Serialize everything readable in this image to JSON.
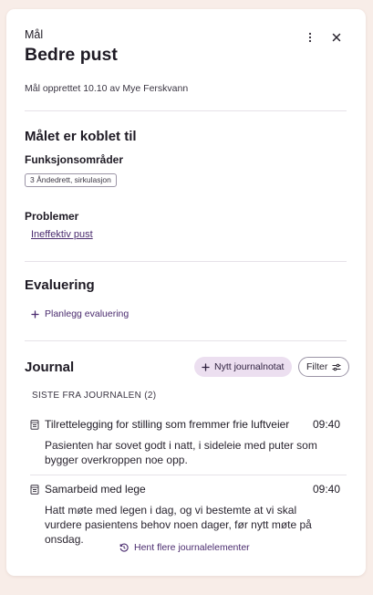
{
  "header": {
    "eyebrow": "Mål",
    "title": "Bedre pust",
    "meta": "Mål opprettet 10.10 av Mye Ferskvann"
  },
  "links_section": {
    "heading": "Målet er koblet til",
    "functional_areas_label": "Funksjonsområder",
    "functional_area_tag": "3 Åndedrett, sirkulasjon",
    "problems_label": "Problemer",
    "problem_link": "Ineffektiv pust"
  },
  "evaluation": {
    "heading": "Evaluering",
    "plan_button": "Planlegg evaluering"
  },
  "journal": {
    "heading": "Journal",
    "new_note_button": "Nytt journalnotat",
    "filter_button": "Filter",
    "recent_label": "SISTE FRA JOURNALEN (2)",
    "entries": [
      {
        "title": "Tilrettelegging for stilling som fremmer frie luftveier",
        "time": "09:40",
        "body": "Pasienten har sovet godt i natt, i sideleie med puter som bygger overkroppen noe opp."
      },
      {
        "title": "Samarbeid med lege",
        "time": "09:40",
        "body": "Hatt møte med legen i dag, og vi bestemte at vi skal vurdere pasientens behov noen dager, før nytt møte på onsdag."
      }
    ],
    "load_more_button": "Hent flere journalelementer"
  },
  "colors": {
    "page_background": "#f8ede8",
    "accent": "#4a2b6e",
    "pill_background": "#ecdff0"
  },
  "icons": [
    "more-vertical-icon",
    "close-icon",
    "plus-icon",
    "filter-sliders-icon",
    "note-document-icon",
    "history-icon"
  ]
}
